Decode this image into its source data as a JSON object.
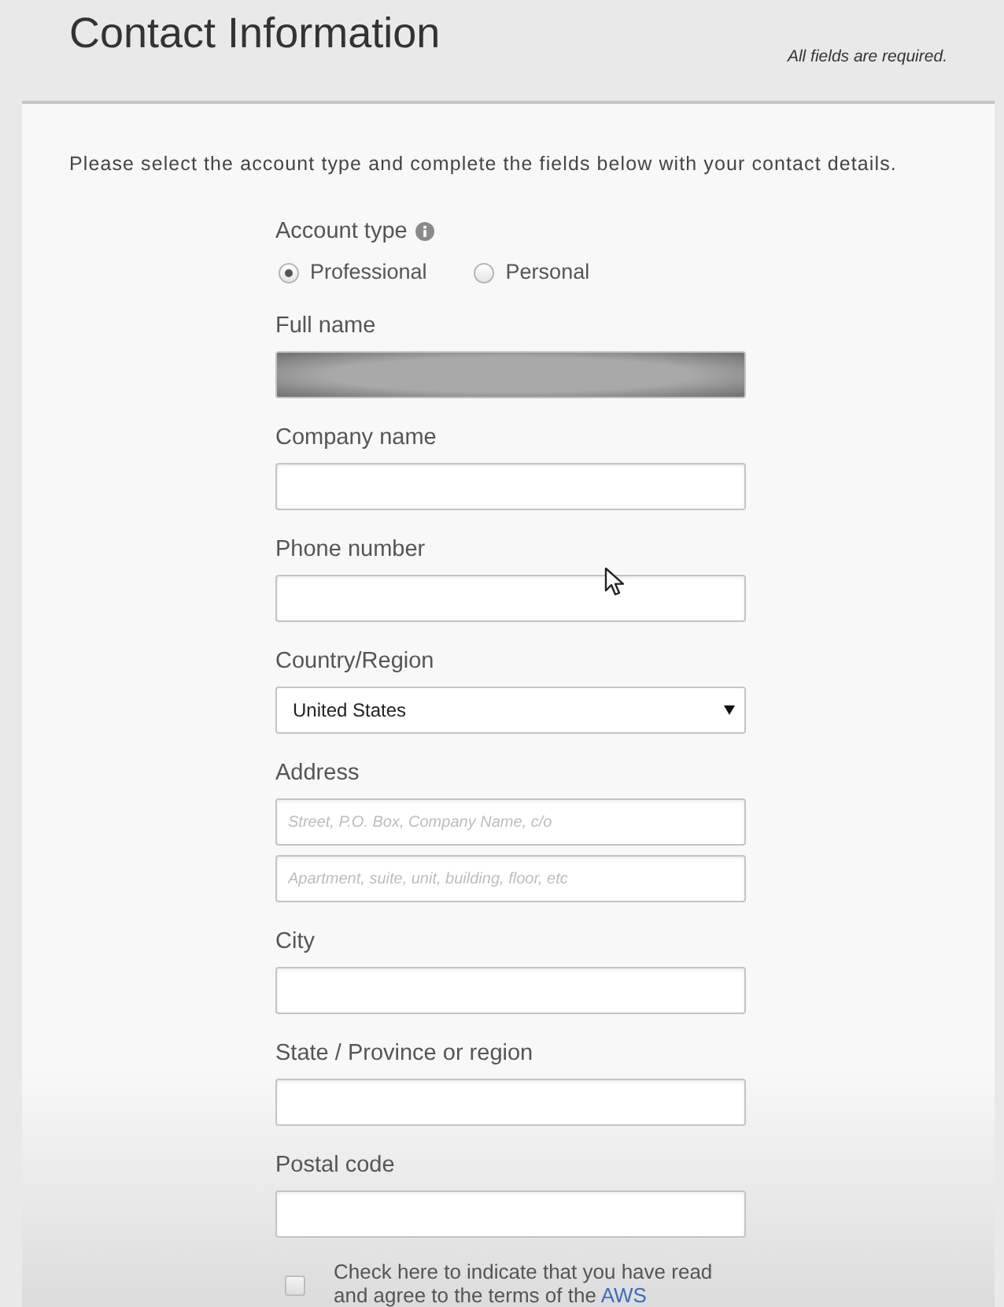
{
  "header": {
    "title": "Contact Information",
    "note": "All fields are required."
  },
  "intro": "Please select the account type and complete the fields below with your contact details.",
  "account_type": {
    "label": "Account type",
    "options": [
      {
        "label": "Professional",
        "selected": true
      },
      {
        "label": "Personal",
        "selected": false
      }
    ]
  },
  "fields": [
    {
      "kind": "text",
      "label": "Full name",
      "redacted": true
    },
    {
      "kind": "text",
      "label": "Company name",
      "redacted": false
    },
    {
      "kind": "text",
      "label": "Phone number",
      "redacted": false
    },
    {
      "kind": "select",
      "label": "Country/Region",
      "value": "United States"
    },
    {
      "kind": "address",
      "label": "Address",
      "placeholders": [
        "Street, P.O. Box, Company Name, c/o",
        "Apartment, suite, unit, building, floor, etc"
      ]
    },
    {
      "kind": "text",
      "label": "City",
      "redacted": false
    },
    {
      "kind": "text",
      "label": "State / Province or region",
      "redacted": false
    },
    {
      "kind": "text",
      "label": "Postal code",
      "redacted": false
    }
  ],
  "terms": {
    "text": "Check here to indicate that you have read and agree to the terms of the",
    "link": "AWS",
    "checked": false
  }
}
